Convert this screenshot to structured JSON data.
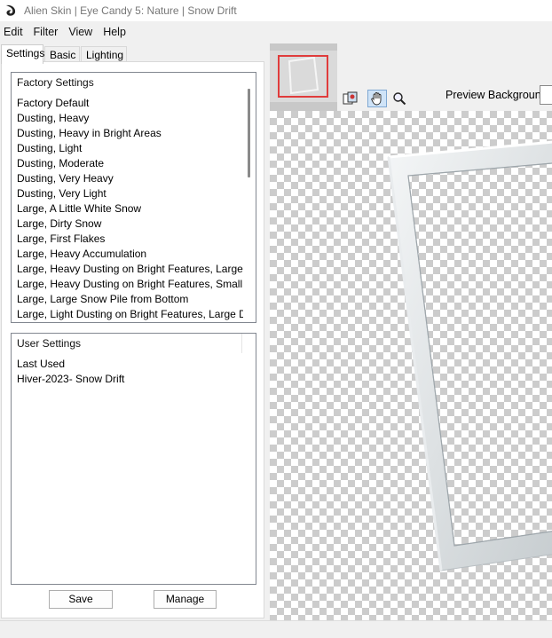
{
  "window": {
    "title": "Alien Skin | Eye Candy 5: Nature | Snow Drift"
  },
  "menu": {
    "items": [
      "Edit",
      "Filter",
      "View",
      "Help"
    ]
  },
  "tabs": [
    "Settings",
    "Basic",
    "Lighting"
  ],
  "factory_settings": {
    "header": "Factory Settings",
    "items": [
      "Factory Default",
      "Dusting, Heavy",
      "Dusting, Heavy in Bright Areas",
      "Dusting, Light",
      "Dusting, Moderate",
      "Dusting, Very Heavy",
      "Dusting, Very Light",
      "Large, A Little White Snow",
      "Large, Dirty Snow",
      "Large, First Flakes",
      "Large, Heavy Accumulation",
      "Large, Heavy Dusting on Bright Features, Large Drift",
      "Large, Heavy Dusting on Bright Features, Small Drift",
      "Large, Large Snow Pile from Bottom",
      "Large, Light Dusting on Bright Features, Large Drift"
    ]
  },
  "user_settings": {
    "header": "User Settings",
    "items": [
      "Last Used",
      "Hiver-2023- Snow Drift"
    ]
  },
  "buttons": {
    "save": "Save",
    "manage": "Manage"
  },
  "preview": {
    "background_label": "Preview Background:"
  },
  "icons": {
    "app": "eye-candy-logo-icon",
    "tool_1": "preview-toggle-icon",
    "tool_2": "hand-pan-icon",
    "tool_3": "zoom-icon"
  },
  "colors": {
    "navigator_highlight": "#e03c3c",
    "active_tool": "#cfe3f7"
  }
}
